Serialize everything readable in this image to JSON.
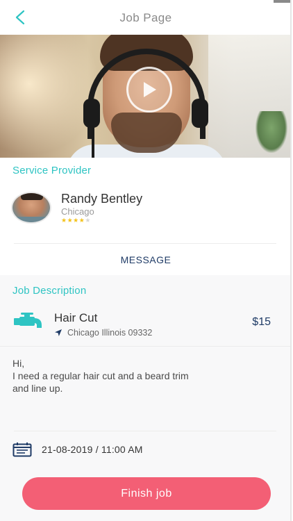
{
  "header": {
    "title": "Job Page",
    "back_icon": "chevron-left-icon"
  },
  "video": {
    "play_icon": "play-icon"
  },
  "service_provider": {
    "section_label": "Service Provider",
    "name": "Randy Bentley",
    "city": "Chicago",
    "rating": 4,
    "rating_max": 5,
    "message_label": "MESSAGE"
  },
  "job": {
    "section_label": "Job Description",
    "icon": "faucet-icon",
    "title": "Hair Cut",
    "location": "Chicago Illinois 09332",
    "location_icon": "navigation-arrow-icon",
    "price": "$15",
    "message": "Hi,\nI need a regular hair cut and a beard trim\nand line up.",
    "date_icon": "calendar-icon",
    "datetime": "21-08-2019 / 11:00 AM"
  },
  "actions": {
    "finish_label": "Finish job"
  },
  "colors": {
    "accent_teal": "#2ec4c3",
    "navy": "#1f3b66",
    "finish_button": "#f35f75",
    "star": "#f3c21a"
  }
}
